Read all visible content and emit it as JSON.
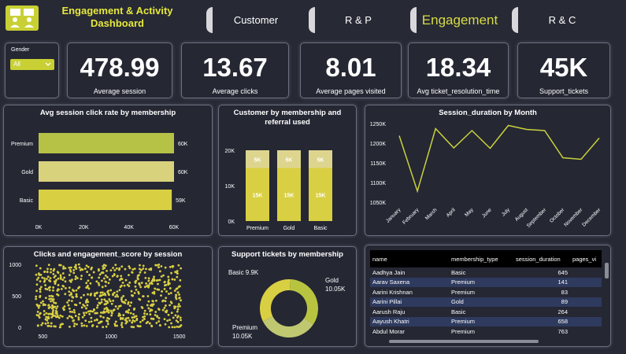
{
  "header": {
    "title": "Engagement & Activity Dashboard",
    "tabs": [
      {
        "label": "Customer"
      },
      {
        "label": "R & P"
      },
      {
        "label": "Engagement"
      },
      {
        "label": "R & C"
      }
    ]
  },
  "filter": {
    "label": "Gender",
    "value": "All"
  },
  "kpis": [
    {
      "value": "478.99",
      "label": "Average session"
    },
    {
      "value": "13.67",
      "label": "Average clicks"
    },
    {
      "value": "8.01",
      "label": "Average pages visited"
    },
    {
      "value": "18.34",
      "label": "Avg ticket_resolution_time"
    },
    {
      "value": "45K",
      "label": "Support_tickets"
    }
  ],
  "chart_data": [
    {
      "type": "bar",
      "orientation": "horizontal",
      "title": "Avg session click rate by membership",
      "categories": [
        "Premium",
        "Gold",
        "Basic"
      ],
      "values": [
        60000,
        60000,
        59000
      ],
      "data_labels": [
        "60K",
        "60K",
        "59K"
      ],
      "xticks": [
        "0K",
        "20K",
        "40K",
        "60K"
      ],
      "xlim": [
        0,
        60000
      ],
      "colors": [
        "#b5c246",
        "#d9d27d",
        "#d9cf42"
      ]
    },
    {
      "type": "bar",
      "stacked": true,
      "title": "Customer by membership and referral used",
      "categories": [
        "Premium",
        "Gold",
        "Basic"
      ],
      "series": [
        {
          "values": [
            15000,
            15000,
            15000
          ],
          "labels": [
            "15K",
            "15K",
            "15K"
          ],
          "color": "#d9cf42"
        },
        {
          "values": [
            5000,
            5000,
            5000
          ],
          "labels": [
            "5K",
            "5K",
            "5K"
          ],
          "color": "#ddd58e"
        }
      ],
      "yticks": [
        "0K",
        "10K",
        "20K"
      ],
      "ylim": [
        0,
        20000
      ]
    },
    {
      "type": "line",
      "title": "Session_duration by Month",
      "x": [
        "January",
        "February",
        "March",
        "April",
        "May",
        "June",
        "July",
        "August",
        "September",
        "October",
        "November",
        "December"
      ],
      "y": [
        1219000,
        1078000,
        1237000,
        1188000,
        1232000,
        1187000,
        1245000,
        1235000,
        1232000,
        1163000,
        1159000,
        1213000
      ],
      "yticks": [
        "1050K",
        "1100K",
        "1150K",
        "1200K",
        "1250K"
      ],
      "ylim": [
        1050000,
        1250000
      ],
      "color": "#c9d13c"
    },
    {
      "type": "scatter",
      "title": "Clicks and engagement_score by session",
      "xticks": [
        "500",
        "1000",
        "1500"
      ],
      "yticks": [
        "0",
        "500",
        "1000"
      ],
      "xlim": [
        400,
        1600
      ],
      "ylim": [
        0,
        1000
      ],
      "color": "#d9cf42"
    },
    {
      "type": "pie",
      "donut": true,
      "title": "Support tickets by membership",
      "slices": [
        {
          "name": "Basic",
          "value": 9900,
          "label": "Basic 9.9K",
          "color": "#d9cf42"
        },
        {
          "name": "Gold",
          "value": 10050,
          "label": "Gold 10.05K",
          "color": "#b8c440"
        },
        {
          "name": "Premium",
          "value": 10050,
          "label": "Premium 10.05K",
          "color": "#bfc870"
        }
      ]
    }
  ],
  "table": {
    "columns": [
      "name",
      "membership_type",
      "session_duration",
      "pages_vi"
    ],
    "rows": [
      [
        "Aadhya Jain",
        "Basic",
        "645"
      ],
      [
        "Aarav Saxena",
        "Premium",
        "141"
      ],
      [
        "Aarini Krishnan",
        "Premium",
        "83"
      ],
      [
        "Aarini Pillai",
        "Gold",
        "89"
      ],
      [
        "Aarush Raju",
        "Basic",
        "264"
      ],
      [
        "Aayush Khatri",
        "Premium",
        "658"
      ],
      [
        "Abdul Morar",
        "Premium",
        "763"
      ]
    ]
  }
}
